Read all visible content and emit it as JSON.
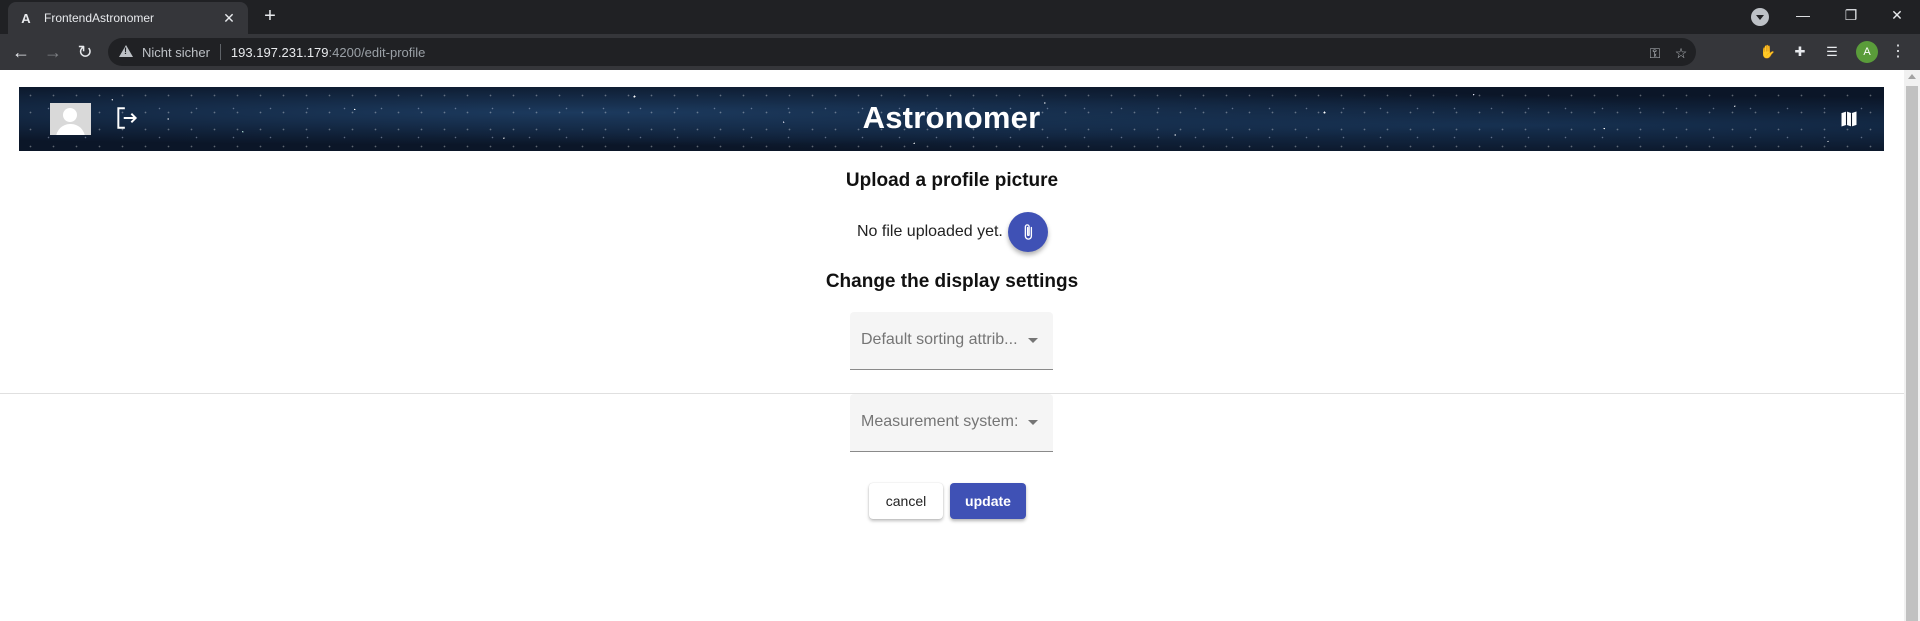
{
  "browser": {
    "tab_title": "FrontendAstronomer",
    "tab_favicon": "A",
    "new_tab_label": "+",
    "security_label": "Nicht sicher",
    "url_host": "193.197.231.179",
    "url_rest": ":4200/edit-profile",
    "profile_initial": "A"
  },
  "header": {
    "brand_title": "Astronomer"
  },
  "upload": {
    "title": "Upload a profile picture",
    "status_text": "No file uploaded yet."
  },
  "display_settings": {
    "title": "Change the display settings",
    "sorting_placeholder": "Default sorting attrib...",
    "measurement_placeholder": "Measurement system:"
  },
  "actions": {
    "cancel_label": "cancel",
    "update_label": "update"
  },
  "colors": {
    "primary": "#3f51b5",
    "browser_dark": "#202124",
    "browser_toolbar": "#35363a",
    "profile_badge": "#5a9c3a",
    "extension_red": "#d93025"
  },
  "icons": [
    "back-icon",
    "forward-icon",
    "reload-icon",
    "warning-icon",
    "key-icon",
    "star-icon",
    "hand-extension-icon",
    "puzzle-icon",
    "reading-list-icon",
    "avatar-icon",
    "logout-icon",
    "map-icon",
    "paperclip-icon",
    "dropdown-arrow-icon"
  ]
}
